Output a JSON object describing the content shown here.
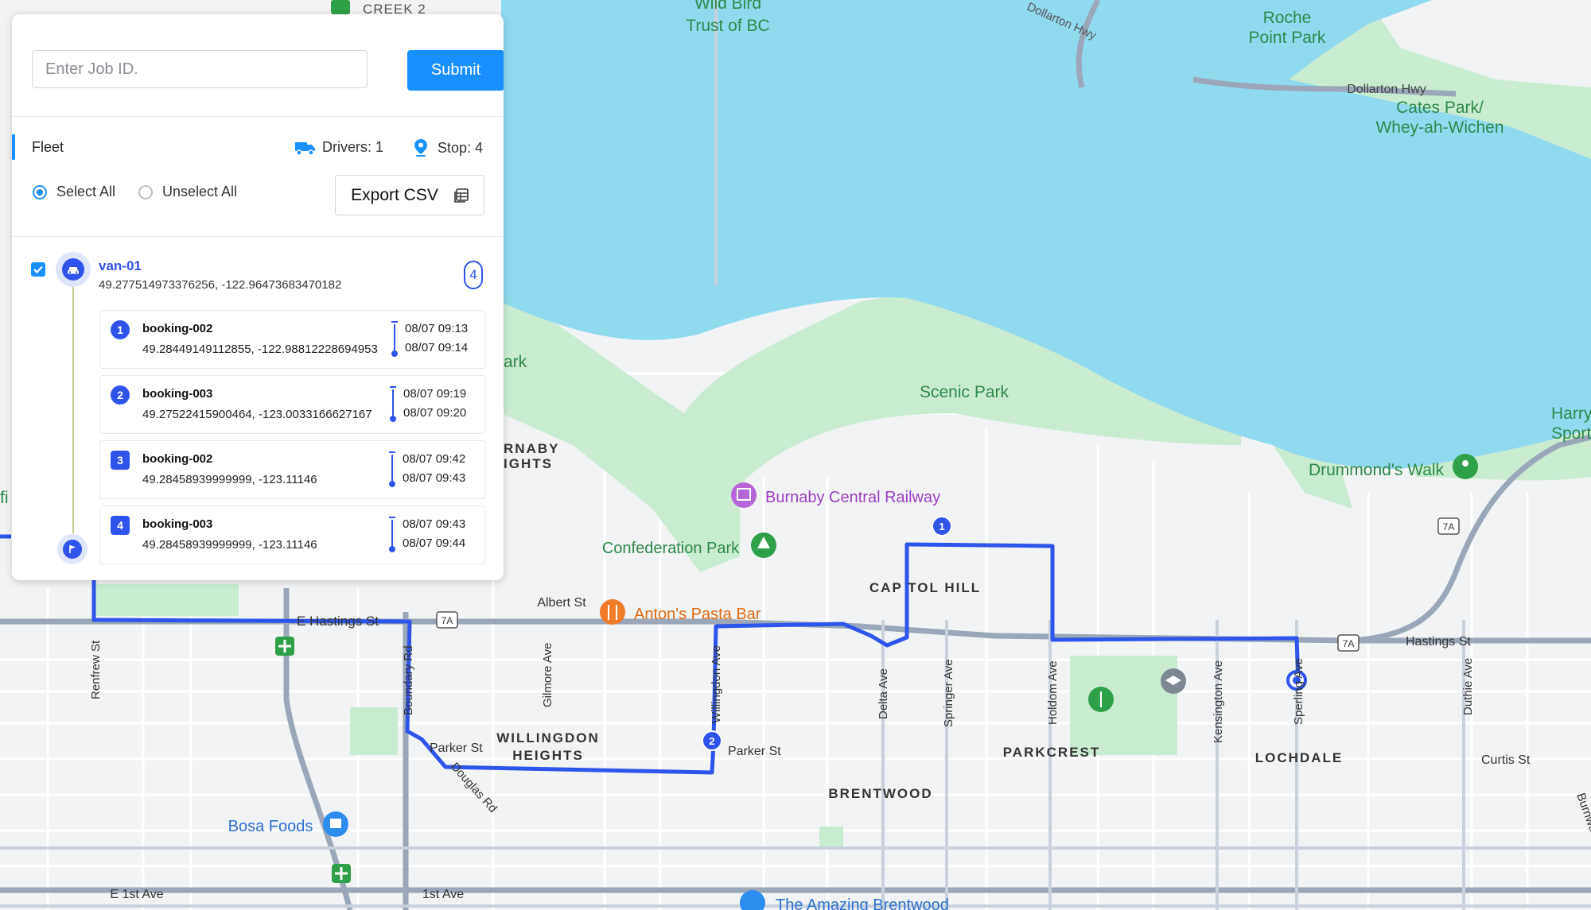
{
  "search": {
    "placeholder": "Enter Job ID.",
    "submit_label": "Submit"
  },
  "fleet": {
    "label": "Fleet",
    "drivers_label": "Drivers: 1",
    "stops_label": "Stop: 4",
    "select_all_label": "Select All",
    "unselect_all_label": "Unselect All",
    "export_label": "Export CSV"
  },
  "vehicle": {
    "name": "van-01",
    "coords": "49.277514973376256, -122.96473683470182",
    "stop_count": "4"
  },
  "stops": [
    {
      "number": "1",
      "booking": "booking-002",
      "coords": "49.28449149112855, -122.98812228694953",
      "arrive": "08/07 09:13",
      "depart": "08/07 09:14"
    },
    {
      "number": "2",
      "booking": "booking-003",
      "coords": "49.27522415900464, -123.0033166627167",
      "arrive": "08/07 09:19",
      "depart": "08/07 09:20"
    },
    {
      "number": "3",
      "booking": "booking-002",
      "coords": "49.28458939999999, -123.11146",
      "arrive": "08/07 09:42",
      "depart": "08/07 09:43"
    },
    {
      "number": "4",
      "booking": "booking-003",
      "coords": "49.28458939999999, -123.11146",
      "arrive": "08/07 09:43",
      "depart": "08/07 09:44"
    }
  ],
  "map": {
    "route_color": "#2f54eb",
    "water_color": "#90daee",
    "park_color": "#c9ecd1",
    "labels": {
      "creek": "CREEK 2",
      "wild_bird_1": "Wild Bird",
      "wild_bird_2": "Trust of BC",
      "dollarton_hwy_top": "Dollarton Hwy",
      "roche_1": "Roche",
      "roche_2": "Point Park",
      "dollarton_hwy": "Dollarton Hwy",
      "cates_1": "Cates Park/",
      "cates_2": "Whey-ah-Wichen",
      "scenic_park": "Scenic Park",
      "harry_1": "Harry J",
      "harry_2": "Sports",
      "drummonds_walk": "Drummond's Walk",
      "burnaby_heights_1": "RNABY",
      "burnaby_heights_2": "IGHTS",
      "park_edge": "ark",
      "fi_edge": "fi",
      "burnaby_central_railway": "Burnaby Central Railway",
      "confederation_park": "Confederation Park",
      "capitol_hill": "CAP TOL HILL",
      "albert_st": "Albert St",
      "antons_pasta_bar": "Anton's Pasta Bar",
      "e_hastings_st": "E Hastings St",
      "hwy_7a_1": "7A",
      "hwy_7a_2": "7A",
      "hwy_7a_3": "7A",
      "hastings_st": "Hastings St",
      "renfrew_st": "Renfrew St",
      "boundary_rd": "Boundary Rd",
      "gilmore_ave": "Gilmore Ave",
      "willingdon_ave": "Willingdon Ave",
      "delta_ave": "Delta Ave",
      "springer_ave": "Springer Ave",
      "holdom_ave": "Holdom Ave",
      "kensington_ave": "Kensington Ave",
      "sperling_ave": "Sperling Ave",
      "duthie_ave": "Duthie Ave",
      "willingdon_heights_1": "WILLINGDON",
      "willingdon_heights_2": "HEIGHTS",
      "parker_st_1": "Parker St",
      "parker_st_2": "Parker St",
      "douglas_rd": "Douglas Rd",
      "parkcrest": "PARKCREST",
      "lochdale": "LOCHDALE",
      "curtis_st": "Curtis St",
      "brentwood": "BRENTWOOD",
      "bosa_foods": "Bosa Foods",
      "e_1st_ave": "E 1st Ave",
      "first_ave": "1st Ave",
      "amazing_brentwood": "The Amazing Brentwood",
      "burnwood": "Burnwood",
      "marker_1": "1",
      "marker_2": "2"
    }
  }
}
